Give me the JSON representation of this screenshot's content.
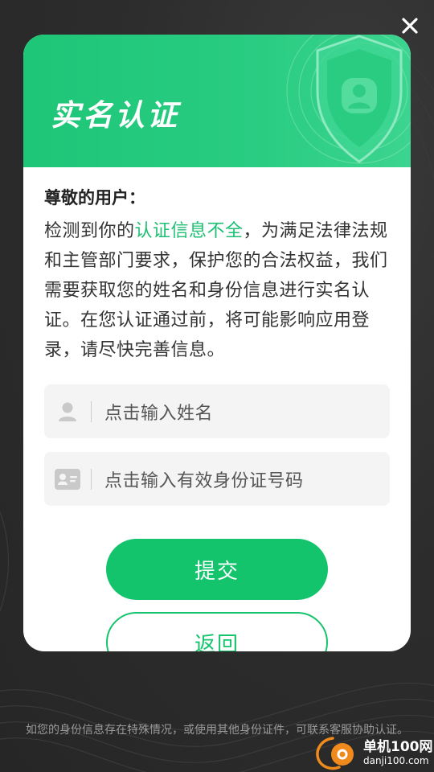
{
  "close": {
    "icon": "close-icon"
  },
  "modal": {
    "title": "实名认证",
    "header_icon": "shield-user-icon",
    "greeting": "尊敬的用户：",
    "notice": {
      "before": "检测到你的",
      "highlight": "认证信息不全",
      "after": "，为满足法律法规和主管部门要求，保护您的合法权益，我们需要获取您的姓名和身份信息进行实名认证。在您认证通过前，将可能影响应用登录，请尽快完善信息。"
    },
    "name_field": {
      "icon": "user-icon",
      "placeholder": "点击输入姓名"
    },
    "id_field": {
      "icon": "id-card-icon",
      "placeholder": "点击输入有效身份证号码"
    },
    "submit_label": "提交",
    "back_label": "返回"
  },
  "footer": {
    "note": "如您的身份信息存在特殊情况，或使用其他身份证件，可联系客服协助认证。"
  },
  "colors": {
    "accent": "#14c46c",
    "highlight": "#1fbf73",
    "header_start": "#1ec677",
    "header_end": "#3cd490"
  }
}
